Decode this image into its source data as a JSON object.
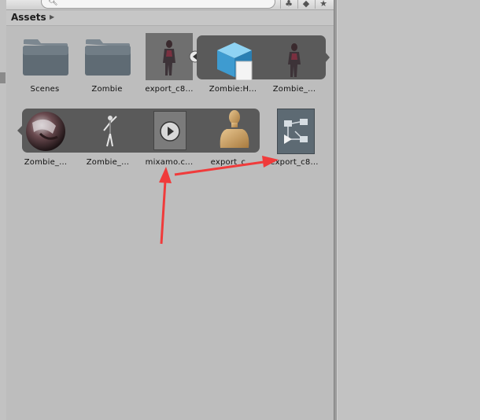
{
  "header": {
    "title": "Assets"
  },
  "toolbar": {
    "search_placeholder": "",
    "icons": [
      "filter-icon",
      "label-icon",
      "star-icon"
    ]
  },
  "assets_row1": [
    {
      "label": "Scenes",
      "kind": "folder"
    },
    {
      "label": "Zombie",
      "kind": "folder"
    },
    {
      "label": "export_c8...",
      "kind": "model"
    },
    {
      "label": "Zombie:H...",
      "kind": "mesh"
    },
    {
      "label": "Zombie_...",
      "kind": "model"
    }
  ],
  "assets_row2": [
    {
      "label": "Zombie_...",
      "kind": "texture"
    },
    {
      "label": "Zombie_...",
      "kind": "model"
    },
    {
      "label": "mixamo.c...",
      "kind": "animation-clip"
    },
    {
      "label": "export_c...",
      "kind": "avatar"
    },
    {
      "label": "export_c8...",
      "kind": "animator-controller"
    }
  ],
  "colors": {
    "annotation_arrow": "#f03b3b",
    "strip": "#5a5a5a",
    "panel": "#bdbdbd"
  }
}
